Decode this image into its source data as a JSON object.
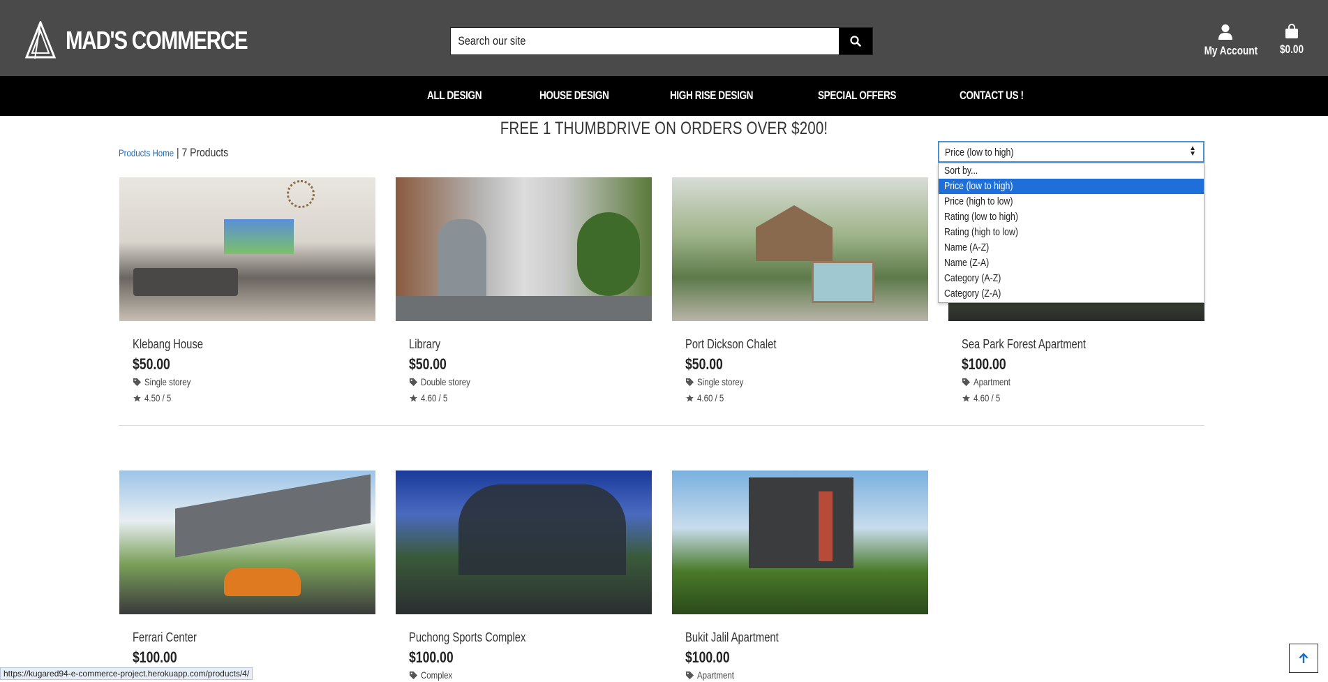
{
  "header": {
    "logo_text": "MAD'S COMMERCE",
    "search_placeholder": "Search our site",
    "account_label": "My Account",
    "cart_total": "$0.00"
  },
  "nav": {
    "items": [
      "ALL DESIGN",
      "HOUSE DESIGN",
      "HIGH RISE DESIGN",
      "SPECIAL OFFERS",
      "CONTACT US !"
    ]
  },
  "promo": "FREE 1 THUMBDRIVE ON ORDERS OVER $200!",
  "breadcrumb": {
    "home_link": "Products Home",
    "count": "| 7 Products"
  },
  "sort": {
    "selected": "Price (low to high)",
    "options": [
      "Sort by...",
      "Price (low to high)",
      "Price (high to low)",
      "Rating (low to high)",
      "Rating (high to low)",
      "Name (A-Z)",
      "Name (Z-A)",
      "Category (A-Z)",
      "Category (Z-A)"
    ]
  },
  "products": [
    {
      "name": "Klebang House",
      "price": "$50.00",
      "category": "Single storey",
      "rating": "4.50 / 5"
    },
    {
      "name": "Library",
      "price": "$50.00",
      "category": "Double storey",
      "rating": "4.60 / 5"
    },
    {
      "name": "Port Dickson Chalet",
      "price": "$50.00",
      "category": "Single storey",
      "rating": "4.60 / 5"
    },
    {
      "name": "Sea Park Forest Apartment",
      "price": "$100.00",
      "category": "Apartment",
      "rating": "4.60 / 5"
    },
    {
      "name": "Ferrari Center",
      "price": "$100.00",
      "category": "",
      "rating": ""
    },
    {
      "name": "Puchong Sports Complex",
      "price": "$100.00",
      "category": "Complex",
      "rating": ""
    },
    {
      "name": "Bukit Jalil Apartment",
      "price": "$100.00",
      "category": "Apartment",
      "rating": ""
    }
  ],
  "status_url": "https://kugared94-e-commerce-project.herokuapp.com/products/4/",
  "colors": {
    "header_bg": "#4a4a4a",
    "nav_bg": "#000000",
    "link": "#1a6fc4",
    "select_highlight": "#1e6fd9"
  }
}
